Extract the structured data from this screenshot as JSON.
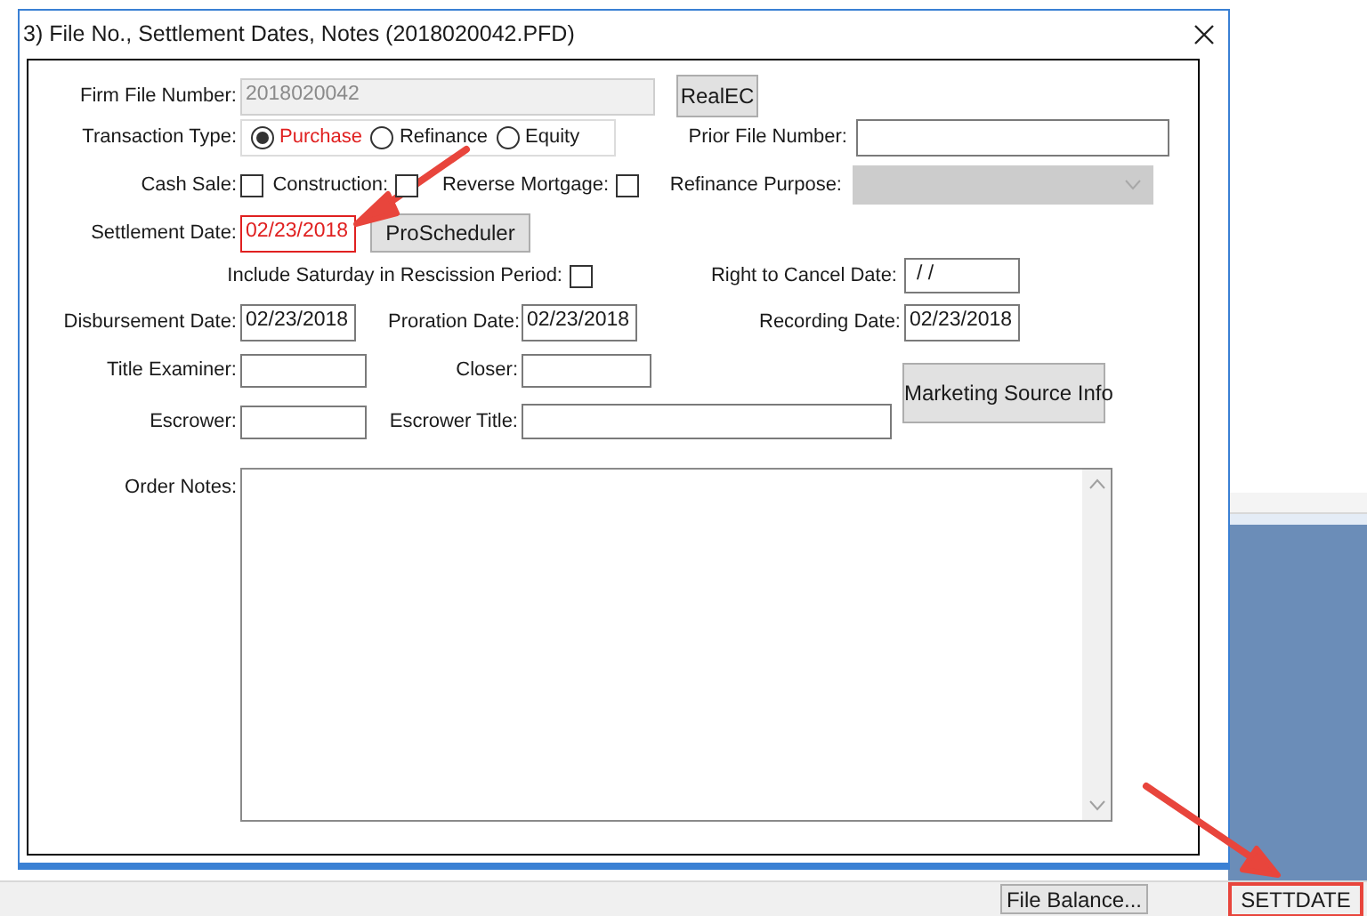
{
  "window": {
    "title": "3) File No., Settlement Dates, Notes (2018020042.PFD)"
  },
  "form": {
    "firm_file_number": {
      "label": "Firm File Number:",
      "value": "2018020042",
      "disabled": true
    },
    "realec_button": "RealEC",
    "transaction_type": {
      "label": "Transaction Type:",
      "options": [
        {
          "label": "Purchase",
          "selected": true
        },
        {
          "label": "Refinance",
          "selected": false
        },
        {
          "label": "Equity",
          "selected": false
        }
      ]
    },
    "prior_file_number": {
      "label": "Prior File Number:"
    },
    "checkboxes": [
      {
        "label": "Cash Sale:",
        "checked": false
      },
      {
        "label": "Construction:",
        "checked": false
      },
      {
        "label": "Reverse Mortgage:",
        "checked": false
      }
    ],
    "refinance_purpose": {
      "label": "Refinance Purpose:",
      "disabled": true
    },
    "settlement_date": {
      "label": "Settlement Date:",
      "value": "02/23/2018",
      "highlighted": true
    },
    "proscheduler_button": "ProScheduler",
    "include_saturday": {
      "label": "Include Saturday in Rescission Period:",
      "checked": false
    },
    "right_to_cancel_date": {
      "label": "Right to Cancel Date:",
      "value": "/ /"
    },
    "disbursement_date": {
      "label": "Disbursement Date:",
      "value": "02/23/2018"
    },
    "proration_date": {
      "label": "Proration Date:",
      "value": "02/23/2018"
    },
    "recording_date": {
      "label": "Recording Date:",
      "value": "02/23/2018"
    },
    "title_examiner": {
      "label": "Title Examiner:"
    },
    "closer": {
      "label": "Closer:"
    },
    "escrower": {
      "label": "Escrower:"
    },
    "escrower_title": {
      "label": "Escrower Title:"
    },
    "marketing_source_button": "Marketing Source Info",
    "order_notes": {
      "label": "Order Notes:"
    }
  },
  "status_bar": {
    "file_balance_button": "File Balance...",
    "code": "SETTDATE"
  }
}
